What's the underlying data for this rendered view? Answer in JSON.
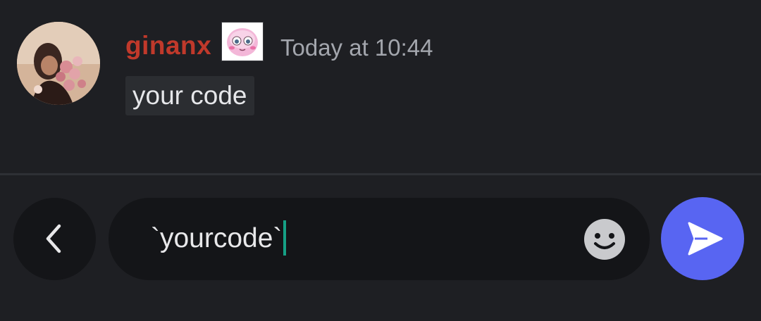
{
  "message": {
    "username": "ginanx",
    "timestamp": "Today at 10:44",
    "content_code": "your code",
    "avatar_icon": "user-avatar-photo",
    "badge_icon": "pink-blob-emoji",
    "username_color": "#c0392b"
  },
  "composer": {
    "input_value": "`yourcode`",
    "back_icon": "chevron-left-icon",
    "emoji_icon": "smiley-face-icon",
    "send_icon": "paper-plane-send-icon",
    "send_color": "#5865f2",
    "caret_color": "#16a085"
  }
}
